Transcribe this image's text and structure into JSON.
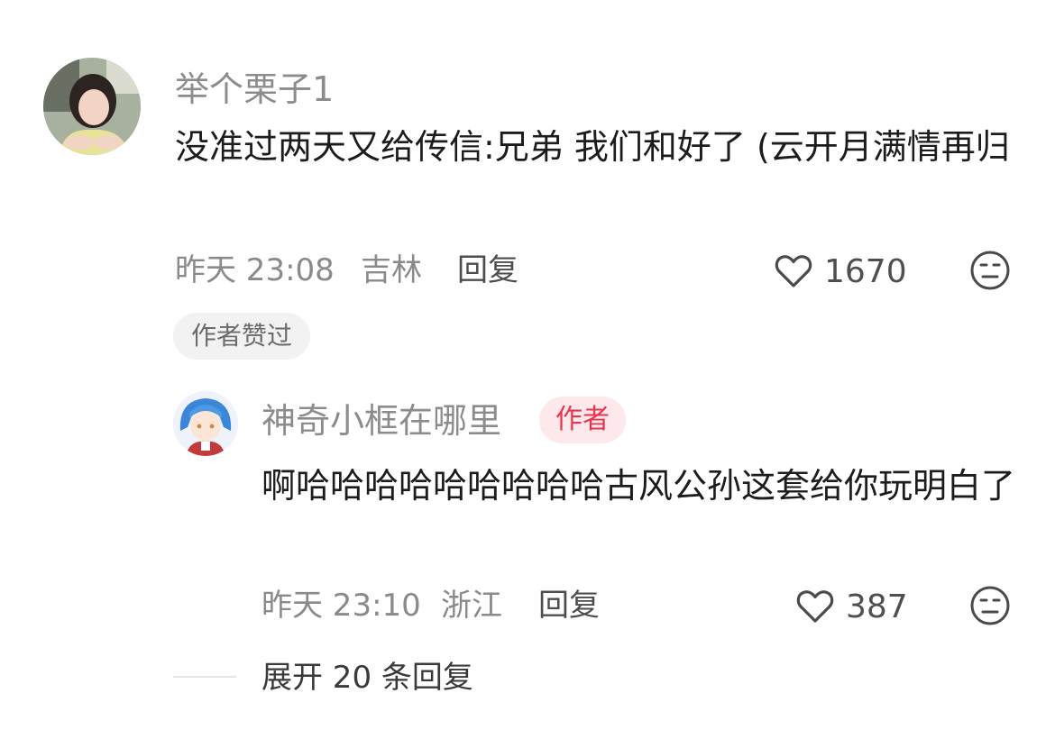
{
  "comment": {
    "username": "举个栗子1",
    "text": "没准过两天又给传信:兄弟 我们和好了 (云开月满情再归",
    "time": "昨天 23:08",
    "location": "吉林",
    "reply_label": "回复",
    "like_count": "1670",
    "author_liked_tag": "作者赞过"
  },
  "reply": {
    "username": "神奇小框在哪里",
    "author_badge": "作者",
    "text": "啊哈哈哈哈哈哈哈哈哈古风公孙这套给你玩明白了",
    "time": "昨天 23:10",
    "location": "浙江",
    "reply_label": "回复",
    "like_count": "387"
  },
  "expand": {
    "label": "展开 20 条回复"
  }
}
